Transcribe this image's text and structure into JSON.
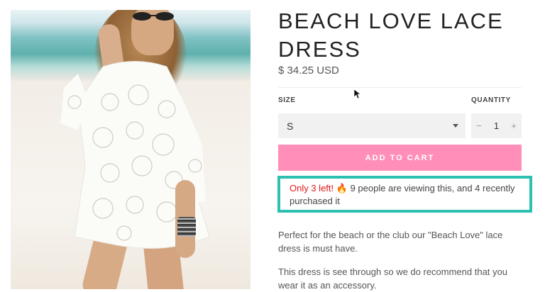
{
  "product": {
    "title": "BEACH LOVE LACE DRESS",
    "price": "$ 34.25 USD",
    "image_alt": "Woman wearing white lace dress on beach"
  },
  "options": {
    "size_label": "SIZE",
    "size_value": "S",
    "quantity_label": "QUANTITY",
    "quantity_value": "1",
    "decrement_label": "−",
    "increment_label": "+"
  },
  "cart": {
    "add_to_cart_label": "ADD TO CART"
  },
  "urgency": {
    "alert": "Only 3 left!",
    "icon": "fire-icon",
    "icon_glyph": "🔥",
    "message": " 9 people are viewing this, and 4 recently purchased it"
  },
  "description": {
    "paragraph_1": "Perfect for the beach or the club our \"Beach Love\" lace dress is must have.",
    "paragraph_2": "This dress is see through so we do recommend that you wear it as an accessory."
  },
  "colors": {
    "accent_pink": "#ff8fb9",
    "highlight_teal": "#2dbfb0",
    "alert_red": "#e8161b"
  }
}
